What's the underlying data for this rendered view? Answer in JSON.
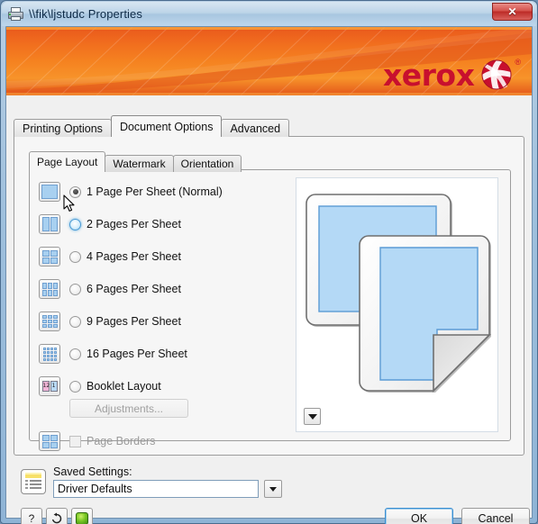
{
  "window": {
    "title": "\\\\fik\\ljstudc Properties",
    "icon": "printer-icon",
    "close_label": "✕"
  },
  "banner": {
    "brand": "xerox",
    "registered_mark": "®",
    "accent_color": "#c8102e",
    "background_color": "#f58220"
  },
  "tabs": [
    {
      "label": "Printing Options",
      "selected": false
    },
    {
      "label": "Document Options",
      "selected": true
    },
    {
      "label": "Advanced",
      "selected": false
    }
  ],
  "subtabs": [
    {
      "label": "Page Layout",
      "selected": true
    },
    {
      "label": "Watermark",
      "selected": false
    },
    {
      "label": "Orientation",
      "selected": false
    }
  ],
  "page_layout": {
    "options": [
      {
        "label": "1 Page Per Sheet (Normal)",
        "selected": true,
        "hover": false,
        "cols": 1,
        "rows": 1
      },
      {
        "label": "2 Pages Per Sheet",
        "selected": false,
        "hover": true,
        "cols": 2,
        "rows": 1
      },
      {
        "label": "4 Pages Per Sheet",
        "selected": false,
        "hover": false,
        "cols": 2,
        "rows": 2
      },
      {
        "label": "6 Pages Per Sheet",
        "selected": false,
        "hover": false,
        "cols": 3,
        "rows": 2
      },
      {
        "label": "9 Pages Per Sheet",
        "selected": false,
        "hover": false,
        "cols": 3,
        "rows": 3
      },
      {
        "label": "16 Pages Per Sheet",
        "selected": false,
        "hover": false,
        "cols": 4,
        "rows": 4
      }
    ],
    "booklet": {
      "label": "Booklet Layout",
      "selected": false,
      "icon_left_text": "12",
      "icon_right_text": "1"
    },
    "adjustments_button": {
      "label": "Adjustments...",
      "enabled": false
    },
    "page_borders": {
      "label": "Page Borders",
      "checked": false,
      "enabled": false
    }
  },
  "preview": {
    "dropdown_glyph": "▼"
  },
  "saved_settings": {
    "label": "Saved Settings:",
    "value": "Driver Defaults",
    "dropdown_glyph": "▼",
    "icon": "saved-settings-icon"
  },
  "footer": {
    "help_label": "?",
    "restore_label": "↺",
    "status_icon": "green-status-icon",
    "ok_label": "OK",
    "cancel_label": "Cancel"
  }
}
